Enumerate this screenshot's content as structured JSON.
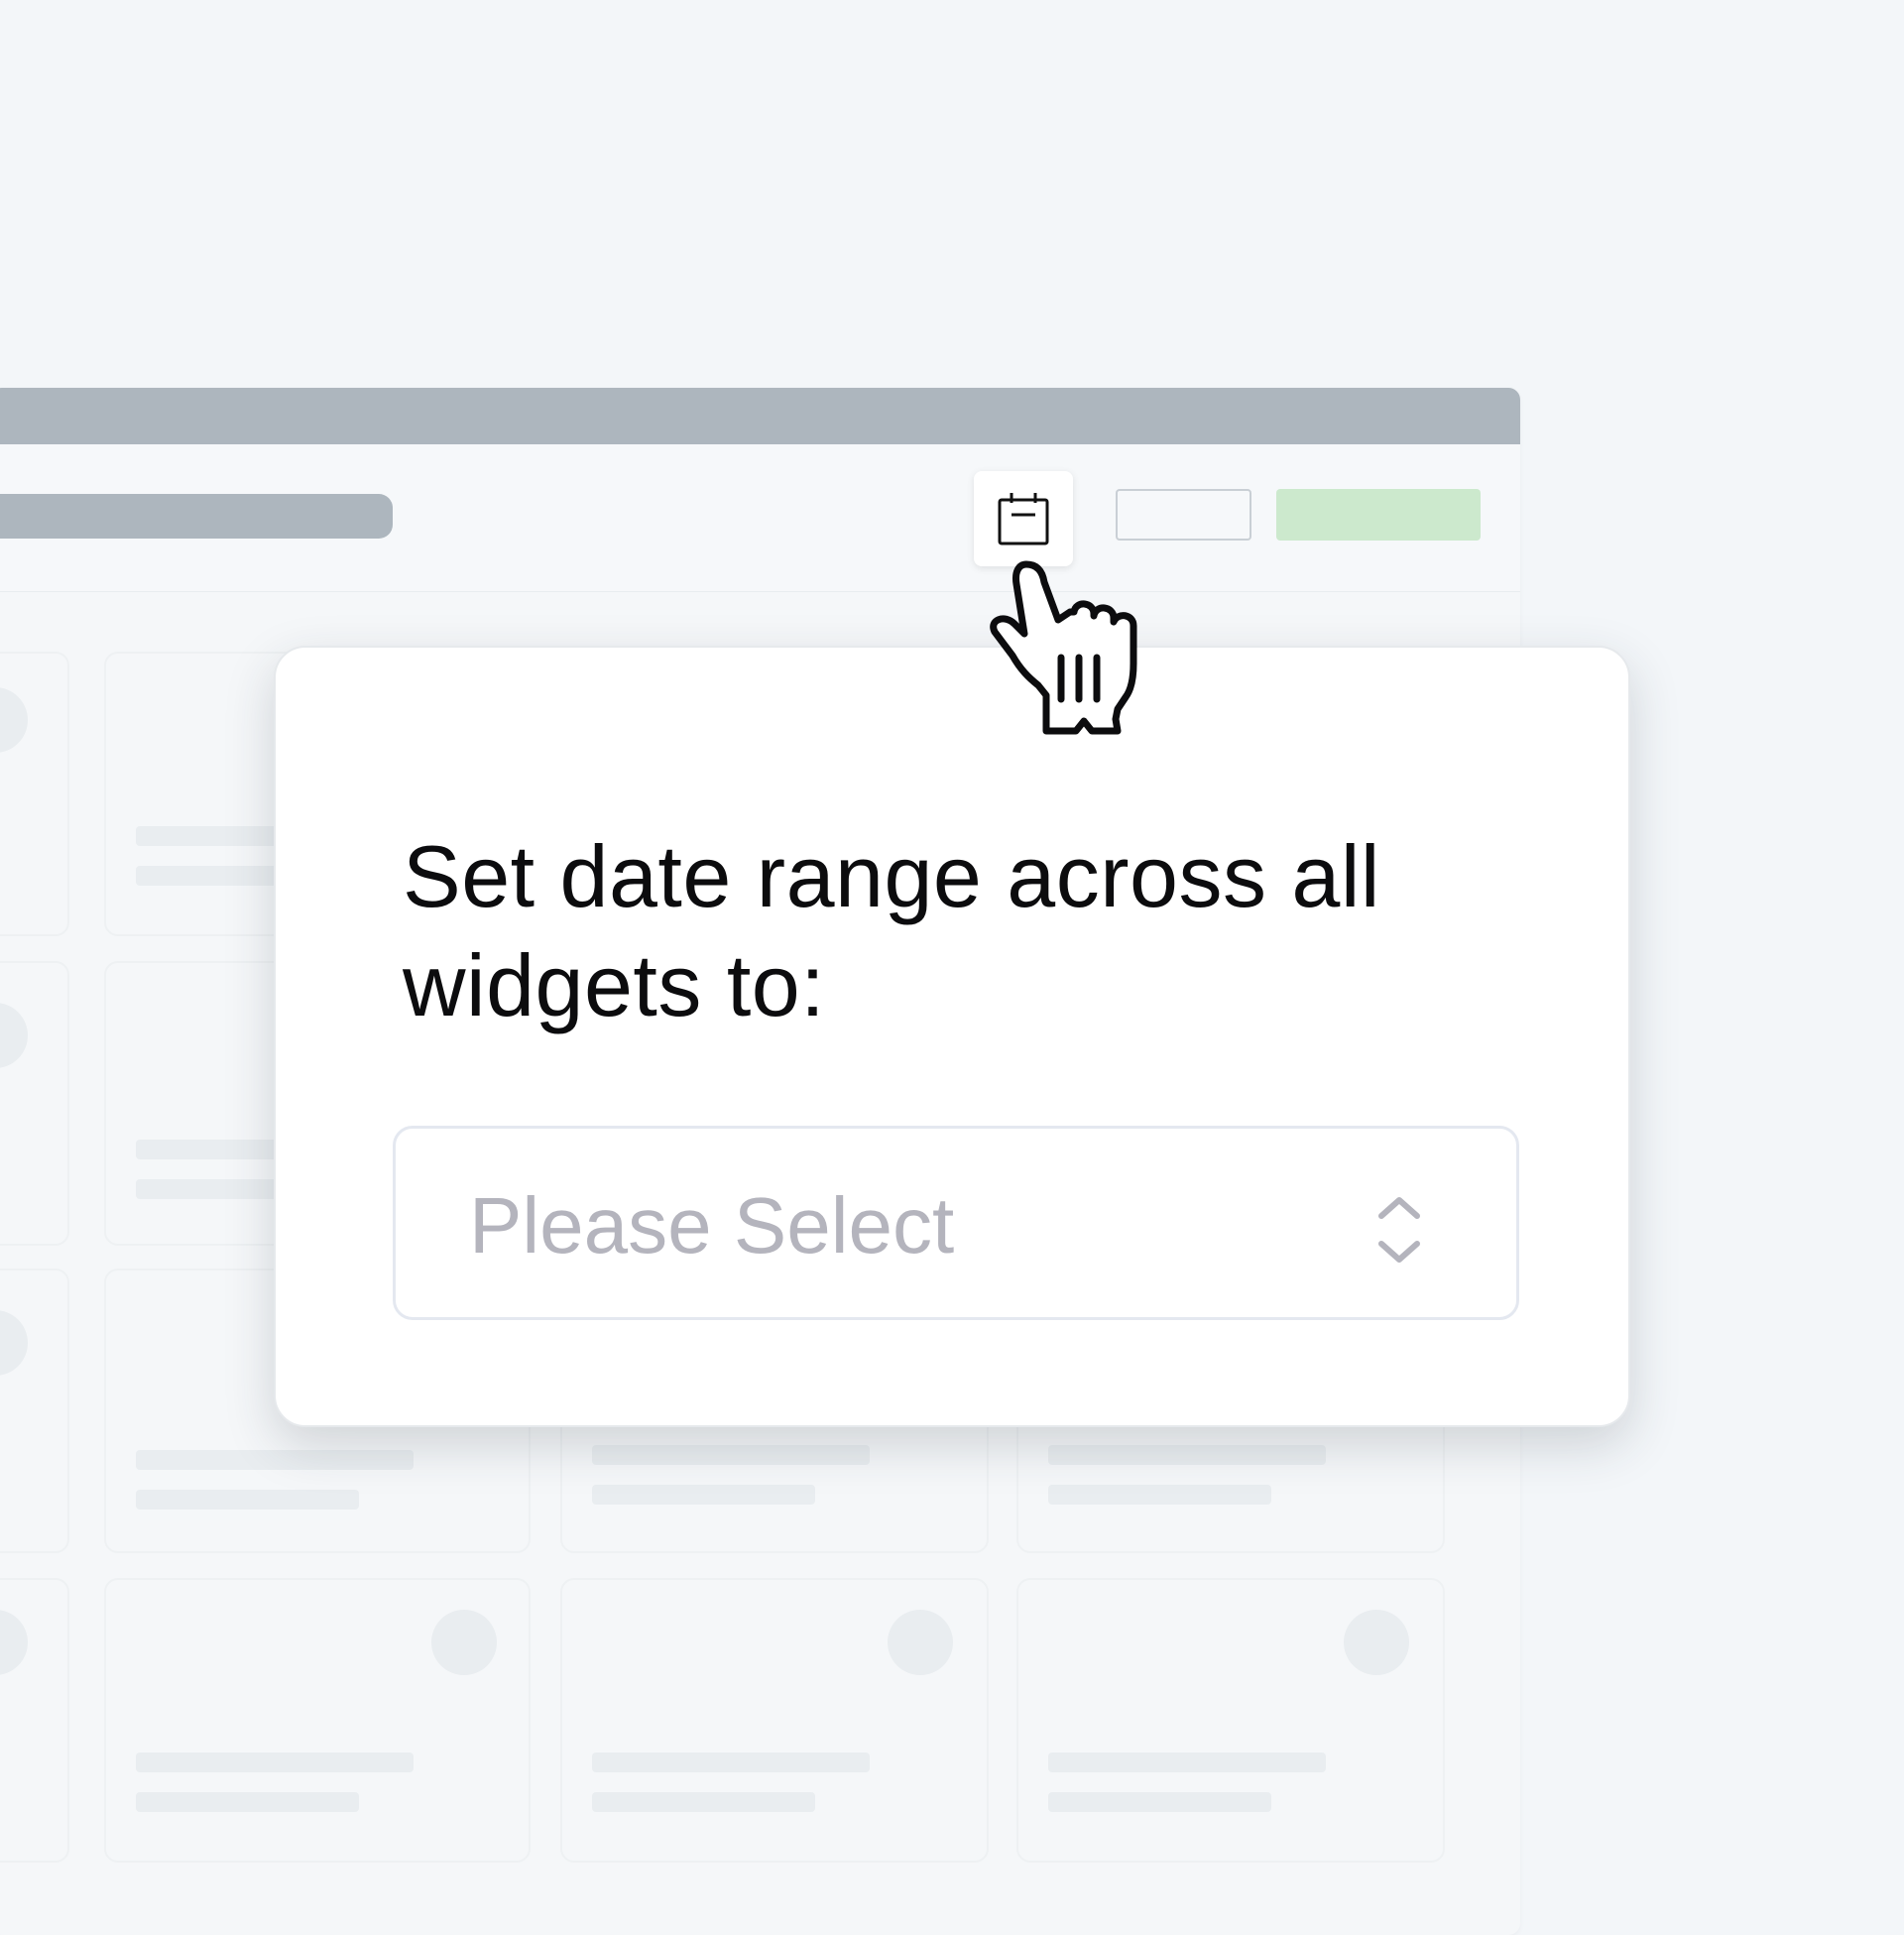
{
  "toolbar": {
    "calendar_icon": "calendar-icon"
  },
  "popover": {
    "title": "Set date range across all widgets to:",
    "select": {
      "placeholder": "Please Select",
      "icon": "chevron-up-down-icon"
    }
  },
  "cursor": {
    "icon": "hand-pointer-icon"
  },
  "colors": {
    "background": "#f3f6f9",
    "titlebar": "#adb6be",
    "primary_button": "#cce9cd",
    "placeholder_text": "#b4b4bd",
    "title_text": "#0c0c0e"
  }
}
